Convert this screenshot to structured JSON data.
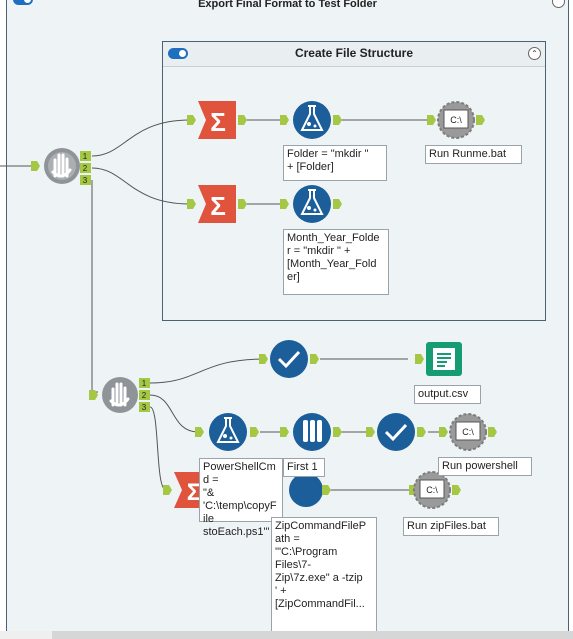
{
  "outer_container": {
    "title": "Export Final Format to Test Folder"
  },
  "inner_container": {
    "title": "Create File Structure"
  },
  "anchors": {
    "a1": "1",
    "a2": "2",
    "a3": "3"
  },
  "tools": {
    "folder_formula_label": "Folder = \"mkdir \"\n+ [Folder]",
    "run_runme_label": "Run Runme.bat",
    "month_formula_label": "Month_Year_Folde\nr = \"mkdir \" +\n[Month_Year_Fold\ner]",
    "output_label": "output.csv",
    "powershell_cmd_label": "PowerShellCmd =\n\"&\n'C:\\temp\\copyFile\nstoEach.ps1'\"",
    "first_label": "First 1",
    "run_powershell_label": "Run powershell",
    "zip_formula_label": "ZipCommandFileP\nath =\n'\"C:\\Program\nFiles\\7-\nZip\\7z.exe\" a -tzip\n' +\n[ZipCommandFil...",
    "run_zip_label": "Run zipFiles.bat",
    "runcommand_glyph": "C:\\",
    "summarize_glyph": "Σ"
  },
  "icons": {
    "summarize": "summarize-icon",
    "formula": "formula-flask-icon",
    "runcommand": "run-command-icon",
    "block_until_done": "block-until-done-hand-icon",
    "select": "select-check-icon",
    "output": "output-data-book-icon",
    "sample": "sample-tubes-icon"
  },
  "colors": {
    "summarize": "#e0533c",
    "formula": "#1b5e9a",
    "runcommand": "#9a9a9a",
    "block": "#8f9498",
    "output": "#169c73",
    "anchor": "#a4c844",
    "connector": "#555555"
  }
}
